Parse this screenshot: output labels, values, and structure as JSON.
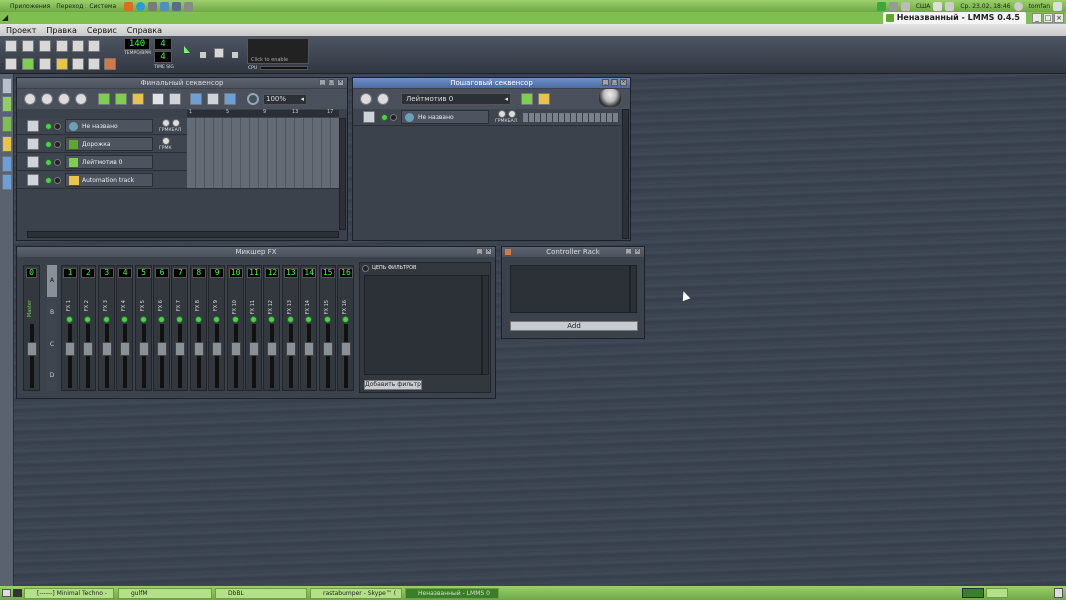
{
  "top_panel": {
    "menu": [
      "Приложения",
      "Переход",
      "Система"
    ],
    "keyboard_layout": "США",
    "clock": "Ср. 23.02, 18:46",
    "user": "tomfan"
  },
  "window": {
    "title": "Неназванный - LMMS 0.4.5"
  },
  "menubar": [
    "Проект",
    "Правка",
    "Сервис",
    "Справка"
  ],
  "toolbar": {
    "tempo": "140",
    "tempo_label": "TEMPO/BPM",
    "timesig_num": "4",
    "timesig_den": "4",
    "timesig_label": "TIME SIG",
    "cpu_label": "CPU",
    "click_label": "Click to enable"
  },
  "song_editor": {
    "title": "Финальный секвенсор",
    "zoom": "100%",
    "ruler": [
      "1",
      "5",
      "9",
      "13",
      "17"
    ],
    "tracks": [
      {
        "name": "Не названо",
        "knob_label": "ГРМКБАЛ"
      },
      {
        "name": "Дорожка",
        "knob_label": "ГРМК"
      },
      {
        "name": "Лейтмотив 0",
        "knob_label": ""
      },
      {
        "name": "Automation track",
        "knob_label": ""
      }
    ]
  },
  "bb_editor": {
    "title": "Пошаговый секвенсор",
    "pattern": "Лейтмотив 0",
    "track": {
      "name": "Не названо",
      "knob_label": "ГРМКБАЛ"
    }
  },
  "mixer": {
    "title": "Микшер FX",
    "master_num": "0",
    "master_label": "Master",
    "channels": [
      "1",
      "2",
      "3",
      "4",
      "5",
      "6",
      "7",
      "8",
      "9",
      "10",
      "11",
      "12",
      "13",
      "14",
      "15",
      "16"
    ],
    "channel_prefix": "FX",
    "banks": [
      "A",
      "B",
      "C",
      "D"
    ],
    "effects_label": "ЦЕПЬ ФИЛЬТРОВ",
    "add_effect": "Добавить фильтр"
  },
  "controller_rack": {
    "title": "Controller Rack",
    "add_label": "Add"
  },
  "taskbar": [
    {
      "label": "[------] Minimal Techno -",
      "active": false
    },
    {
      "label": "gulfM",
      "active": false
    },
    {
      "label": "DbBL",
      "active": false
    },
    {
      "label": "rastabumper - Skype™ (",
      "active": false
    },
    {
      "label": "Неназванный - LMMS 0",
      "active": true
    }
  ]
}
